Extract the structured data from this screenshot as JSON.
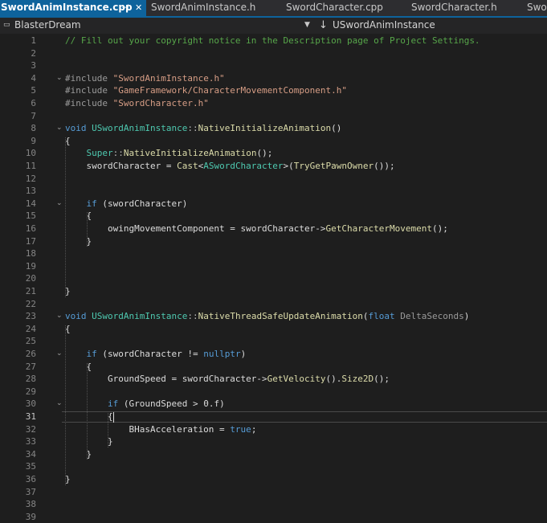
{
  "tabs": [
    {
      "label": "SwordAnimInstance.cpp",
      "active": true,
      "pinned": true,
      "closable": true
    },
    {
      "label": "SwordAnimInstance.h",
      "active": false
    },
    {
      "label": "SwordCharacter.cpp",
      "active": false
    },
    {
      "label": "SwordCharacter.h",
      "active": false
    },
    {
      "label": "Swo",
      "active": false
    }
  ],
  "navbar": {
    "project_combo": "BlasterDream",
    "scope_combo": "USwordAnimInstance"
  },
  "editor": {
    "current_line": 31,
    "colors": {
      "comment": "#57a64a",
      "string": "#d69d85",
      "keyword": "#569cd6",
      "type": "#4ec9b0",
      "function": "#dcdcaa",
      "accent": "#0e639c"
    },
    "lines": [
      {
        "n": "1",
        "t": [
          [
            "comment",
            "// Fill out your copyright notice in the Description page of Project Settings."
          ]
        ]
      },
      {
        "n": "2",
        "t": []
      },
      {
        "n": "3",
        "t": []
      },
      {
        "n": "4",
        "t": [
          [
            "pre",
            "#include "
          ],
          [
            "string",
            "\"SwordAnimInstance.h\""
          ]
        ]
      },
      {
        "n": "5",
        "t": [
          [
            "pre",
            "#include "
          ],
          [
            "string",
            "\"GameFramework/CharacterMovementComponent.h\""
          ]
        ]
      },
      {
        "n": "6",
        "t": [
          [
            "pre",
            "#include "
          ],
          [
            "string",
            "\"SwordCharacter.h\""
          ]
        ]
      },
      {
        "n": "7",
        "t": []
      },
      {
        "n": "8",
        "t": [
          [
            "kw",
            "void "
          ],
          [
            "type",
            "USwordAnimInstance"
          ],
          [
            "punct",
            "::"
          ],
          [
            "func",
            "NativeInitializeAnimation"
          ],
          [
            "plain",
            "()"
          ]
        ]
      },
      {
        "n": "9",
        "t": [
          [
            "plain",
            "{"
          ]
        ]
      },
      {
        "n": "10",
        "t": [
          [
            "plain",
            "    "
          ],
          [
            "type",
            "Super"
          ],
          [
            "punct",
            "::"
          ],
          [
            "func",
            "NativeInitializeAnimation"
          ],
          [
            "plain",
            "();"
          ]
        ]
      },
      {
        "n": "11",
        "t": [
          [
            "plain",
            "    swordCharacter = "
          ],
          [
            "func",
            "Cast"
          ],
          [
            "plain",
            "<"
          ],
          [
            "type",
            "ASwordCharacter"
          ],
          [
            "plain",
            ">("
          ],
          [
            "func",
            "TryGetPawnOwner"
          ],
          [
            "plain",
            "());"
          ]
        ]
      },
      {
        "n": "12",
        "t": []
      },
      {
        "n": "13",
        "t": []
      },
      {
        "n": "14",
        "t": [
          [
            "plain",
            "    "
          ],
          [
            "kw",
            "if"
          ],
          [
            "plain",
            " (swordCharacter)"
          ]
        ]
      },
      {
        "n": "15",
        "t": [
          [
            "plain",
            "    {"
          ]
        ]
      },
      {
        "n": "16",
        "t": [
          [
            "plain",
            "        owingMovementComponent = swordCharacter->"
          ],
          [
            "func",
            "GetCharacterMovement"
          ],
          [
            "plain",
            "();"
          ]
        ]
      },
      {
        "n": "17",
        "t": [
          [
            "plain",
            "    }"
          ]
        ]
      },
      {
        "n": "18",
        "t": []
      },
      {
        "n": "19",
        "t": []
      },
      {
        "n": "20",
        "t": []
      },
      {
        "n": "21",
        "t": [
          [
            "plain",
            "}"
          ]
        ]
      },
      {
        "n": "22",
        "t": []
      },
      {
        "n": "23",
        "t": [
          [
            "kw",
            "void "
          ],
          [
            "type",
            "USwordAnimInstance"
          ],
          [
            "punct",
            "::"
          ],
          [
            "func",
            "NativeThreadSafeUpdateAnimation"
          ],
          [
            "plain",
            "("
          ],
          [
            "kw",
            "float"
          ],
          [
            "param",
            " DeltaSeconds"
          ],
          [
            "plain",
            ")"
          ]
        ]
      },
      {
        "n": "24",
        "t": [
          [
            "plain",
            "{"
          ]
        ]
      },
      {
        "n": "25",
        "t": []
      },
      {
        "n": "26",
        "t": [
          [
            "plain",
            "    "
          ],
          [
            "kw",
            "if"
          ],
          [
            "plain",
            " (swordCharacter != "
          ],
          [
            "kw",
            "nullptr"
          ],
          [
            "plain",
            ")"
          ]
        ]
      },
      {
        "n": "27",
        "t": [
          [
            "plain",
            "    {"
          ]
        ]
      },
      {
        "n": "28",
        "t": [
          [
            "plain",
            "        GroundSpeed = swordCharacter->"
          ],
          [
            "func",
            "GetVelocity"
          ],
          [
            "plain",
            "()."
          ],
          [
            "func",
            "Size2D"
          ],
          [
            "plain",
            "();"
          ]
        ]
      },
      {
        "n": "29",
        "t": []
      },
      {
        "n": "30",
        "t": [
          [
            "plain",
            "        "
          ],
          [
            "kw",
            "if"
          ],
          [
            "plain",
            " (GroundSpeed > 0.f)"
          ]
        ]
      },
      {
        "n": "31",
        "t": [
          [
            "plain",
            "        {"
          ]
        ]
      },
      {
        "n": "32",
        "t": [
          [
            "plain",
            "            BHasAcceleration = "
          ],
          [
            "kw",
            "true"
          ],
          [
            "plain",
            ";"
          ]
        ]
      },
      {
        "n": "33",
        "t": [
          [
            "plain",
            "        }"
          ]
        ]
      },
      {
        "n": "34",
        "t": [
          [
            "plain",
            "    }"
          ]
        ]
      },
      {
        "n": "35",
        "t": []
      },
      {
        "n": "36",
        "t": [
          [
            "plain",
            "}"
          ]
        ]
      },
      {
        "n": "37",
        "t": []
      },
      {
        "n": "38",
        "t": []
      },
      {
        "n": "39",
        "t": []
      }
    ]
  }
}
